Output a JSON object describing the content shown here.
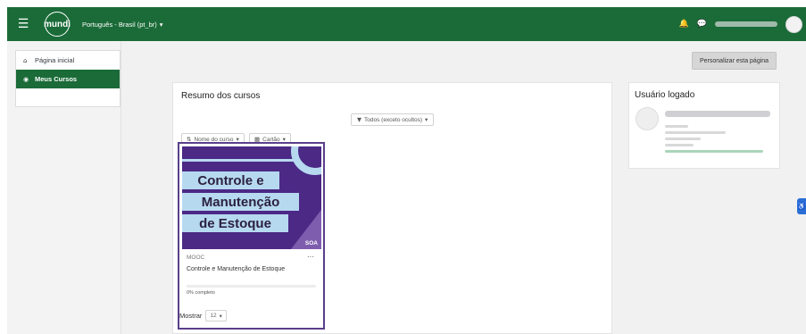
{
  "navbar": {
    "menu_icon": "hamburger-icon",
    "logo_text": "mundi",
    "language": "Português - Brasil (pt_br)",
    "language_caret": "▾",
    "bell_icon": "bell-icon",
    "chat_icon": "chat-icon",
    "brand_color": "#1a6b38"
  },
  "sidebar": {
    "items": [
      {
        "label": "Página inicial",
        "icon": "home-icon",
        "glyph": "🏠"
      },
      {
        "label": "Meus Cursos",
        "icon": "courses-icon",
        "glyph": "⚙"
      }
    ]
  },
  "main": {
    "personalize_label": "Personalizar esta página"
  },
  "courses": {
    "title": "Resumo dos cursos",
    "filter_label": "Todos (exceto ocultos)",
    "sort_label": "Nome do curso",
    "view_label": "Cartão",
    "card": {
      "image_lines": [
        "Controle e",
        "Manutenção",
        "de Estoque"
      ],
      "image_badge": "SOA",
      "category": "MOOC",
      "menu": "···",
      "name": "Controle e Manutenção de Estoque",
      "progress_text": "0% completo",
      "progress": 0
    },
    "show_label": "Mostrar",
    "show_value": "12"
  },
  "user_panel": {
    "title": "Usuário logado"
  }
}
